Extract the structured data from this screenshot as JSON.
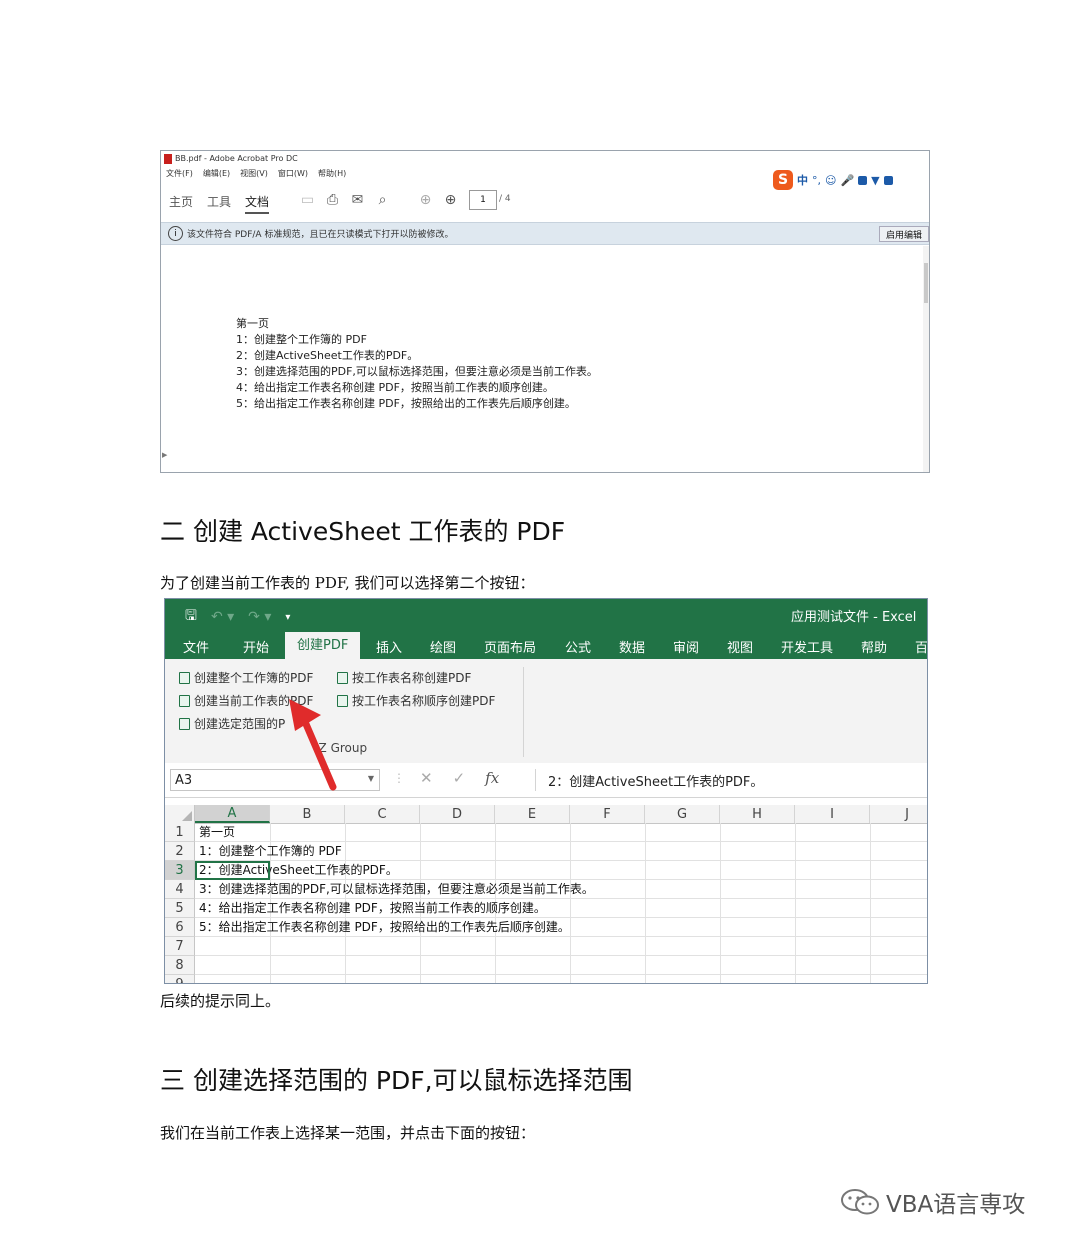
{
  "acrobat": {
    "title": "BB.pdf - Adobe Acrobat Pro DC",
    "menu": [
      "文件(F)",
      "编辑(E)",
      "视图(V)",
      "窗口(W)",
      "帮助(H)"
    ],
    "ime_label": "中",
    "tabs": [
      "主页",
      "工具",
      "文档"
    ],
    "page_current": "1",
    "page_total": "/ 4",
    "info_message": "该文件符合 PDF/A 标准规范，且已在只读模式下打开以防被修改。",
    "enable_edit": "启用编辑",
    "content": [
      "第一页",
      "1：创建整个工作簿的 PDF",
      "2：创建ActiveSheet工作表的PDF。",
      "3：创建选择范围的PDF,可以鼠标选择范围，但要注意必须是当前工作表。",
      "4：给出指定工作表名称创建 PDF，按照当前工作表的顺序创建。",
      "5：给出指定工作表名称创建 PDF，按照给出的工作表先后顺序创建。"
    ]
  },
  "section2": {
    "heading": "二  创建 ActiveSheet 工作表的 PDF",
    "intro": "为了创建当前工作表的 PDF, 我们可以选择第二个按钮：",
    "after": "后续的提示同上。"
  },
  "excel": {
    "title": "应用测试文件  -  Excel",
    "tabs": [
      "文件",
      "开始",
      "创建PDF",
      "插入",
      "绘图",
      "页面布局",
      "公式",
      "数据",
      "审阅",
      "视图",
      "开发工具",
      "帮助",
      "百"
    ],
    "buttons": [
      "创建整个工作簿的PDF",
      "按工作表名称创建PDF",
      "创建当前工作表的PDF",
      "按工作表名称顺序创建PDF",
      "创建选定范围的P"
    ],
    "group_label": "IZ Group",
    "name_box": "A3",
    "formula": "2：创建ActiveSheet工作表的PDF。",
    "columns": [
      "A",
      "B",
      "C",
      "D",
      "E",
      "F",
      "G",
      "H",
      "I",
      "J"
    ],
    "rows": [
      {
        "num": "1",
        "text": "第一页"
      },
      {
        "num": "2",
        "text": "1：创建整个工作簿的 PDF"
      },
      {
        "num": "3",
        "text": "2：创建ActiveSheet工作表的PDF。"
      },
      {
        "num": "4",
        "text": "3：创建选择范围的PDF,可以鼠标选择范围，但要注意必须是当前工作表。"
      },
      {
        "num": "5",
        "text": "4：给出指定工作表名称创建 PDF，按照当前工作表的顺序创建。"
      },
      {
        "num": "6",
        "text": "5：给出指定工作表名称创建 PDF，按照给出的工作表先后顺序创建。"
      },
      {
        "num": "7",
        "text": ""
      },
      {
        "num": "8",
        "text": ""
      },
      {
        "num": "9",
        "text": ""
      }
    ]
  },
  "section3": {
    "heading": "三    创建选择范围的 PDF,可以鼠标选择范围",
    "intro": "我们在当前工作表上选择某一范围，并点击下面的按钮："
  },
  "watermark": "VBA语言専攻",
  "colors": {
    "excel_green": "#217346",
    "arrow_red": "#e02b2b",
    "sogou_orange": "#ee5a1d"
  }
}
